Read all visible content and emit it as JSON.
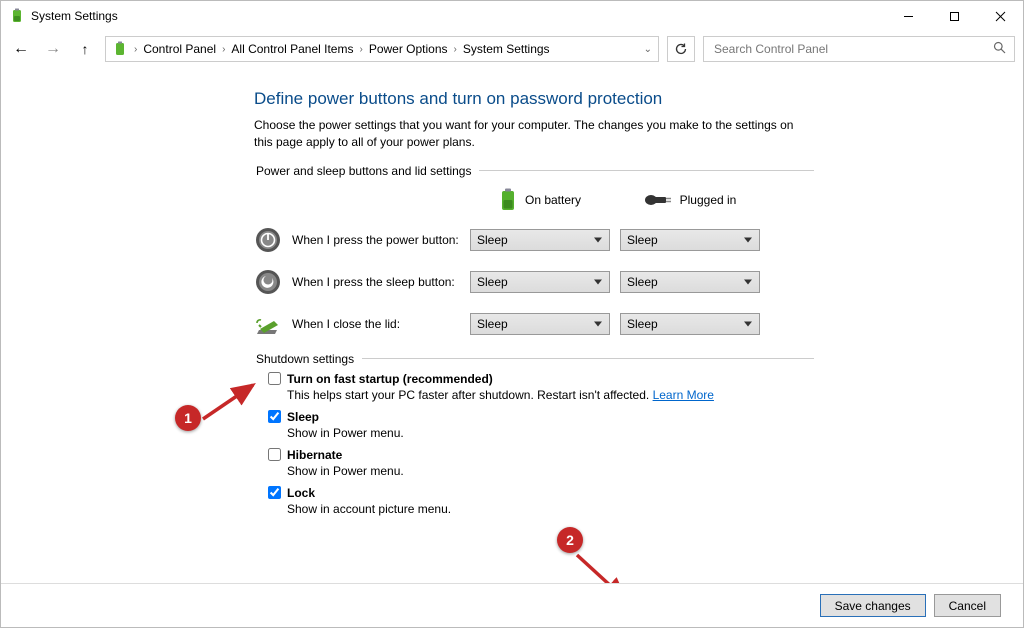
{
  "window": {
    "title": "System Settings"
  },
  "breadcrumbs": {
    "items": [
      "Control Panel",
      "All Control Panel Items",
      "Power Options",
      "System Settings"
    ]
  },
  "search": {
    "placeholder": "Search Control Panel"
  },
  "page": {
    "title": "Define power buttons and turn on password protection",
    "description": "Choose the power settings that you want for your computer. The changes you make to the settings on this page apply to all of your power plans.",
    "group1_legend": "Power and sleep buttons and lid settings",
    "group2_legend": "Shutdown settings",
    "columns": {
      "battery": "On battery",
      "plugged": "Plugged in"
    },
    "rows": {
      "power_button": {
        "label": "When I press the power button:",
        "battery": "Sleep",
        "plugged": "Sleep"
      },
      "sleep_button": {
        "label": "When I press the sleep button:",
        "battery": "Sleep",
        "plugged": "Sleep"
      },
      "close_lid": {
        "label": "When I close the lid:",
        "battery": "Sleep",
        "plugged": "Sleep"
      }
    },
    "shutdown": {
      "fast_startup": {
        "label": "Turn on fast startup (recommended)",
        "desc": "This helps start your PC faster after shutdown. Restart isn't affected.",
        "link": "Learn More",
        "checked": false
      },
      "sleep": {
        "label": "Sleep",
        "desc": "Show in Power menu.",
        "checked": true
      },
      "hibernate": {
        "label": "Hibernate",
        "desc": "Show in Power menu.",
        "checked": false
      },
      "lock": {
        "label": "Lock",
        "desc": "Show in account picture menu.",
        "checked": true
      }
    }
  },
  "footer": {
    "save": "Save changes",
    "cancel": "Cancel"
  },
  "annotations": {
    "badge1": "1",
    "badge2": "2"
  },
  "colors": {
    "accent": "#0a4c8a",
    "link": "#0066cc",
    "annotation": "#c62828"
  }
}
